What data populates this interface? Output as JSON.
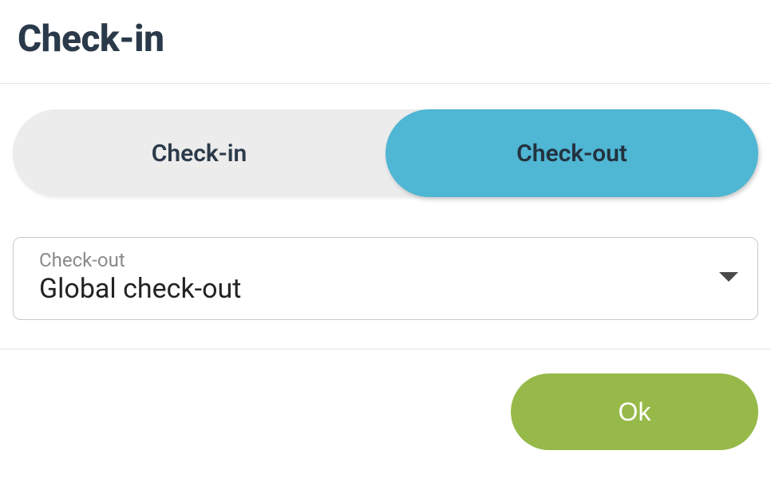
{
  "header": {
    "title": "Check-in"
  },
  "segmented": {
    "options": [
      {
        "label": "Check-in"
      },
      {
        "label": "Check-out"
      }
    ],
    "activeIndex": 1
  },
  "select": {
    "label": "Check-out",
    "value": "Global check-out"
  },
  "footer": {
    "ok_label": "Ok"
  }
}
